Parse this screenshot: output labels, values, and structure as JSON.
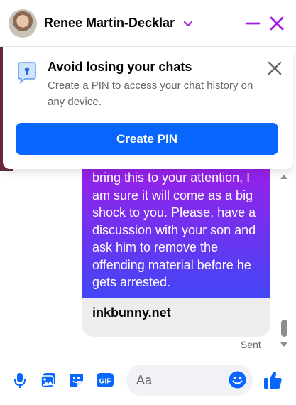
{
  "header": {
    "contact_name": "Renee Martin-Decklar",
    "avatar_icon": "avatar",
    "chevron_icon": "chevron-down-icon",
    "minimize_icon": "minimize-icon",
    "close_icon": "close-icon",
    "accent_color": "#a41ee3"
  },
  "pin_banner": {
    "title": "Avoid losing your chats",
    "description": "Create a PIN to access your chat history on any device.",
    "button_label": "Create PIN",
    "icon": "pin-lock-icon",
    "close_icon": "close-icon",
    "button_color": "#0866ff"
  },
  "message": {
    "text": "bring this to your attention, I am sure it will come as a big shock to you. Please, have a discussion with your son and ask him to remove the offending material before he gets arrested.",
    "link_preview": "inkbunny.net",
    "status": "Sent",
    "gradient_top": "#9b1fe8",
    "gradient_bottom": "#4346f5"
  },
  "composer": {
    "placeholder": "Aa",
    "icons": [
      "microphone-icon",
      "image-icon",
      "sticker-icon",
      "gif-icon",
      "emoji-icon",
      "thumbs-up-icon"
    ],
    "icon_color": "#0866ff"
  }
}
